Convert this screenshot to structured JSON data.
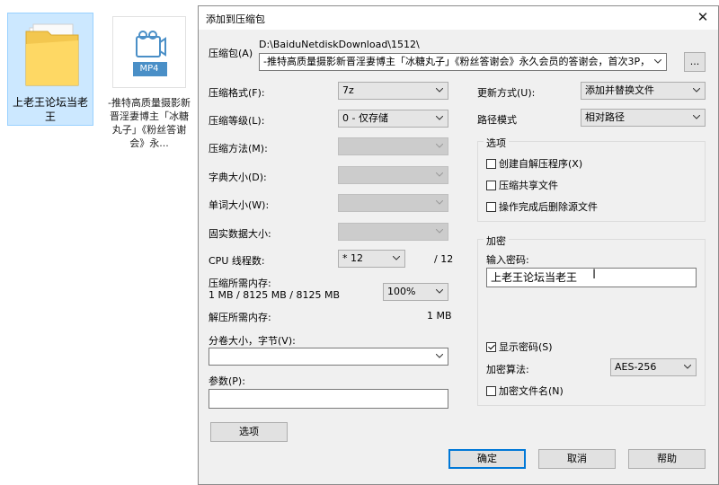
{
  "desktop": {
    "folder_label": "上老王论坛当老王",
    "file_badge": "MP4",
    "file_label": "-推特高质量摄影新晋淫妻博主「冰糖丸子」《粉丝答谢会》永..."
  },
  "dialog": {
    "title": "添加到压缩包",
    "archive_label": "压缩包(A)",
    "archive_path": "D:\\BaiduNetdiskDownload\\1512\\",
    "archive_name": "-推特高质量摄影新晋淫妻博主「冰糖丸子」《粉丝答谢会》永久会员的答谢会，首次3P，",
    "browse_label": "...",
    "format_label": "压缩格式(F):",
    "format_value": "7z",
    "level_label": "压缩等级(L):",
    "level_value": "0 - 仅存储",
    "method_label": "压缩方法(M):",
    "dict_label": "字典大小(D):",
    "word_label": "单词大小(W):",
    "solid_label": "固实数据大小:",
    "cpu_label": "CPU 线程数:",
    "cpu_value": "* 12",
    "cpu_total": "/ 12",
    "mem_compress_label": "压缩所需内存:",
    "mem_compress_value": "1 MB / 8125 MB / 8125 MB",
    "mem_percent": "100%",
    "mem_decompress_label": "解压所需内存:",
    "mem_decompress_value": "1 MB",
    "split_label": "分卷大小，字节(V):",
    "split_value": "",
    "params_label": "参数(P):",
    "params_value": "",
    "options_button": "选项",
    "update_label": "更新方式(U):",
    "update_value": "添加并替换文件",
    "path_label": "路径模式",
    "path_value": "相对路径",
    "options_group": "选项",
    "opt_sfx": "创建自解压程序(X)",
    "opt_shared": "压缩共享文件",
    "opt_delete": "操作完成后删除源文件",
    "encrypt_group": "加密",
    "password_label": "输入密码:",
    "password_value": "上老王论坛当老王",
    "show_password": "显示密码(S)",
    "algo_label": "加密算法:",
    "algo_value": "AES-256",
    "encrypt_names": "加密文件名(N)",
    "ok": "确定",
    "cancel": "取消",
    "help": "帮助"
  }
}
